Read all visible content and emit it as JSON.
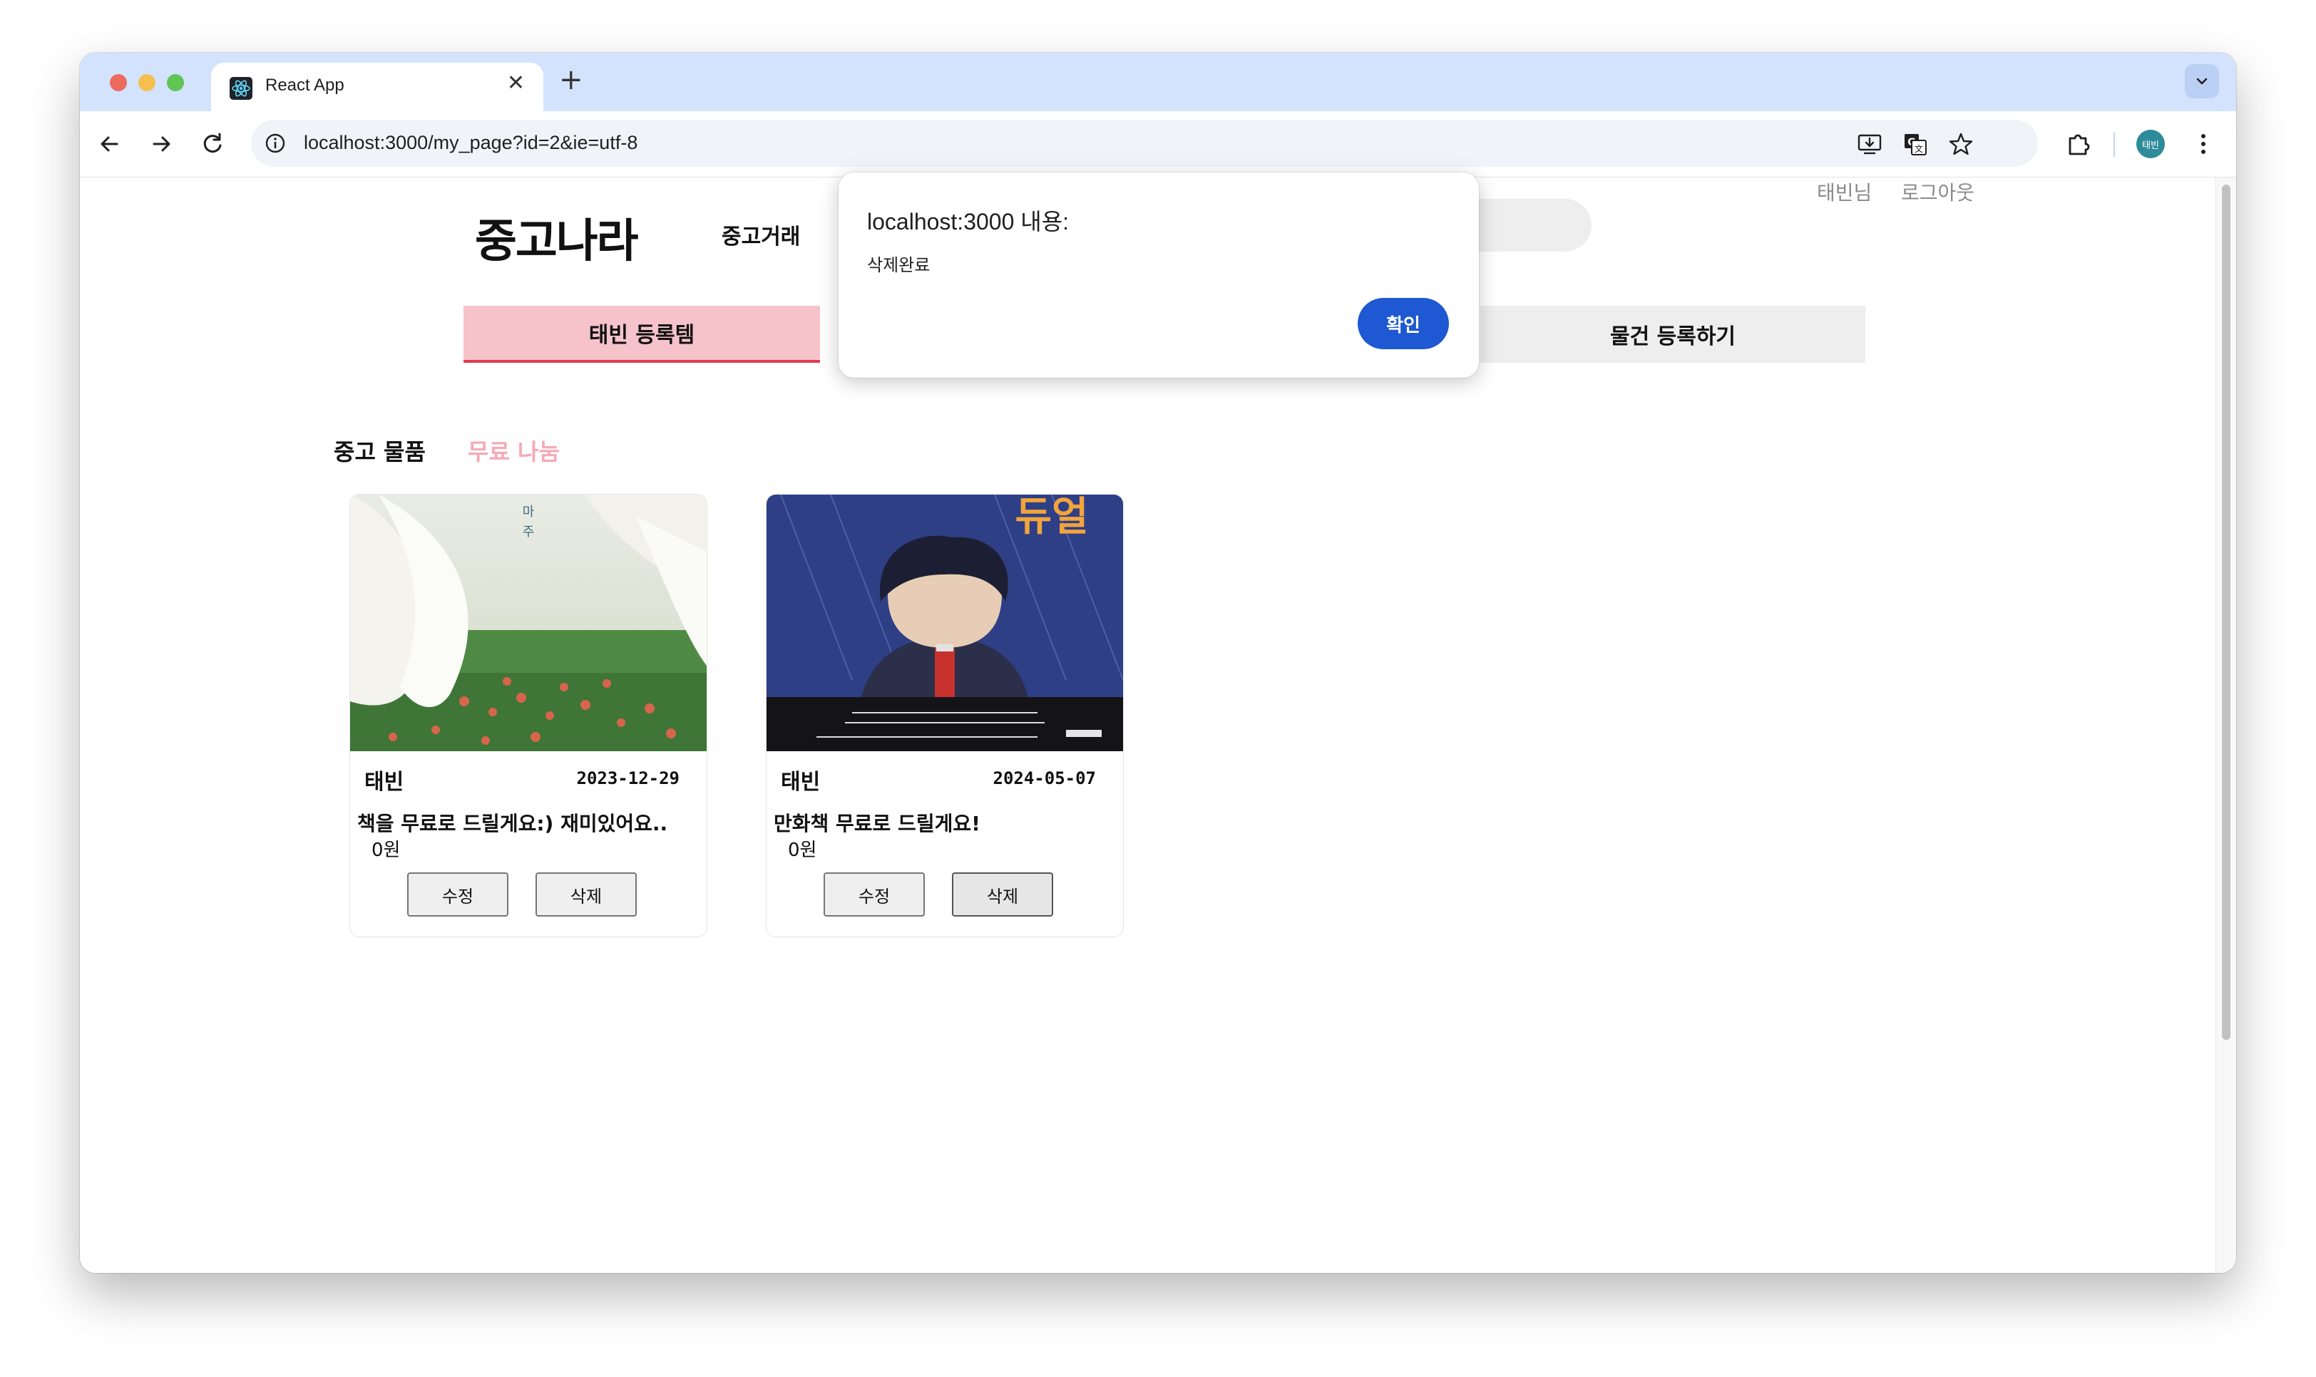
{
  "browser": {
    "tab_title": "React App",
    "tab_close": "✕",
    "new_tab": "+",
    "url": "localhost:3000/my_page?id=2&ie=utf-8",
    "profile_initials": "태빈"
  },
  "site": {
    "logo": "중고나라",
    "nav_trade": "중고거래",
    "user_name": "태빈님",
    "logout": "로그아웃"
  },
  "page_tabs": {
    "my_items": "태빈 등록템",
    "register": "물건 등록하기"
  },
  "sub_tabs": {
    "used": "중고 물품",
    "free": "무료 나눔"
  },
  "cards": [
    {
      "seller": "태빈",
      "date": "2023-12-29",
      "title": "책을 무료로 드릴게요:) 재미있어요..",
      "price": "0원",
      "edit": "수정",
      "delete": "삭제"
    },
    {
      "seller": "태빈",
      "date": "2024-05-07",
      "title": "만화책 무료로 드릴게요!",
      "price": "0원",
      "edit": "수정",
      "delete": "삭제",
      "cover_title": "듀얼"
    }
  ],
  "dialog": {
    "title": "localhost:3000 내용:",
    "message": "삭제완료",
    "ok": "확인"
  },
  "colors": {
    "accent_tab": "#f6c3cb",
    "accent_underline": "#e03a4e",
    "free_tab": "#f4aab6",
    "dialog_button": "#1e58d2",
    "browser_frame": "#d3e3fd"
  }
}
